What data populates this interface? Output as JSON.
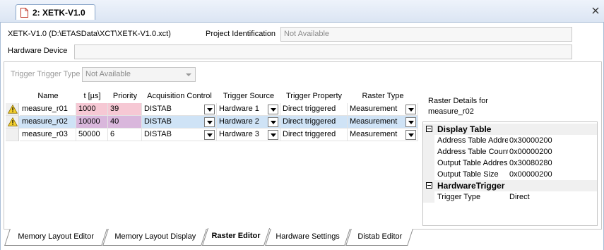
{
  "window": {
    "tab_label": "2: XETK-V1.0",
    "close_icon": "close-icon",
    "tab_icon": "document-icon"
  },
  "header": {
    "project_path": "XETK-V1.0 (D:\\ETASData\\XCT\\XETK-V1.0.xct)",
    "project_identification_label": "Project Identification",
    "project_identification_value": "Not Available",
    "hardware_device_label": "Hardware Device",
    "hardware_device_value": ""
  },
  "trigger": {
    "label": "Trigger Trigger Type",
    "value": "Not Available"
  },
  "grid": {
    "columns": [
      "Name",
      "t [µs]",
      "Priority",
      "Acquisition Control",
      "Trigger Source",
      "Trigger Property",
      "Raster Type"
    ],
    "rows": [
      {
        "name": "measure_r01",
        "t": "1000",
        "priority": "39",
        "acquisition": "DISTAB",
        "source": "Hardware 1",
        "property": "Direct triggered",
        "raster_type": "Measurement",
        "warning": true,
        "selected": false
      },
      {
        "name": "measure_r02",
        "t": "10000",
        "priority": "40",
        "acquisition": "DISTAB",
        "source": "Hardware 2",
        "property": "Direct triggered",
        "raster_type": "Measurement",
        "warning": true,
        "selected": true
      },
      {
        "name": "measure_r03",
        "t": "50000",
        "priority": "6",
        "acquisition": "DISTAB",
        "source": "Hardware 3",
        "property": "Direct triggered",
        "raster_type": "Measurement",
        "warning": false,
        "selected": false
      }
    ]
  },
  "details": {
    "title_line1": "Raster Details for",
    "title_line2": "measure_r02",
    "categories": [
      {
        "name": "Display Table",
        "rows": [
          {
            "name": "Address Table Address",
            "value": "0x30000200"
          },
          {
            "name": "Address Table Count",
            "value": "0x00000200"
          },
          {
            "name": "Output Table Address",
            "value": "0x30080280"
          },
          {
            "name": "Output Table Size",
            "value": "0x00000200"
          }
        ]
      },
      {
        "name": "HardwareTrigger",
        "rows": [
          {
            "name": "Trigger Type",
            "value": "Direct"
          }
        ]
      }
    ]
  },
  "bottom_tabs": [
    {
      "label": "Memory Layout Editor",
      "active": false
    },
    {
      "label": "Memory Layout Display",
      "active": false
    },
    {
      "label": "Raster Editor",
      "active": true
    },
    {
      "label": "Hardware Settings",
      "active": false
    },
    {
      "label": "Distab Editor",
      "active": false
    }
  ],
  "colors": {
    "row1_highlight": "#f6c8d4",
    "row2_selected": "#cfe3f6",
    "row2_highlight": "#d9b7dc",
    "warning": "#f5d130"
  }
}
